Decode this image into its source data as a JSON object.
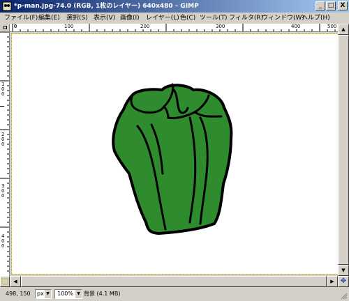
{
  "window": {
    "title": "*p-man.jpg-74.0 (RGB, 1枚のレイヤー) 640x480 – GIMP",
    "minimize_label": "_",
    "maximize_label": "□",
    "close_label": "X"
  },
  "menu": [
    {
      "label": "ファイル(F)"
    },
    {
      "label": "編集(E)"
    },
    {
      "label": "選択(S)"
    },
    {
      "label": "表示(V)"
    },
    {
      "label": "画像(I)"
    },
    {
      "label": "レイヤー(L)"
    },
    {
      "label": "色(C)"
    },
    {
      "label": "ツール(T)"
    },
    {
      "label": "フィルタ(R)"
    },
    {
      "label": "ウィンドウ(W)"
    },
    {
      "label": "ヘルプ(H)"
    }
  ],
  "ruler_top": {
    "labels": [
      "0",
      "100",
      "200",
      "300",
      "400",
      "500"
    ]
  },
  "ruler_left": {
    "labels": [
      "100",
      "200",
      "300",
      "400"
    ]
  },
  "status": {
    "coords": "498, 150",
    "unit": "px",
    "zoom": "100%",
    "layer_info": "背景 (4.1 MB)"
  },
  "colors": {
    "pepper_fill": "#2e8b2e",
    "pepper_outline": "#000000",
    "titlebar_start": "#0a246a",
    "titlebar_end": "#a6caf0"
  },
  "icons": {
    "app": "gimp-wilber-icon",
    "navigate": "navigate-icon",
    "quickmask": "quickmask-icon"
  }
}
